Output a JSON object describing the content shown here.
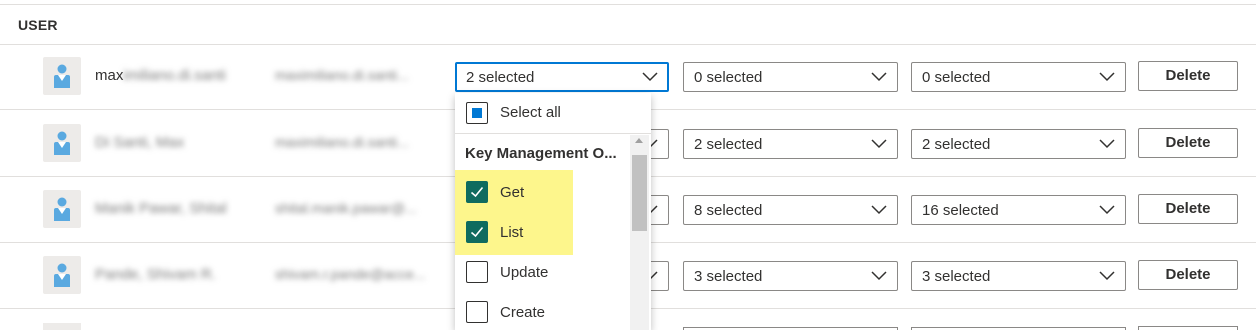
{
  "header": {
    "column_label": "USER"
  },
  "rows": [
    {
      "name_visible": "max",
      "name_obscured": "imiliano.di.santi",
      "email": "maximiliano.di.santi...",
      "dd1": "2 selected",
      "dd2": "0 selected",
      "dd3": "0 selected",
      "delete": "Delete"
    },
    {
      "name_obscured": "Di Santi, Max",
      "email": "maximiliano.di.santi...",
      "dd1": "",
      "dd2": "2 selected",
      "dd3": "2 selected",
      "delete": "Delete"
    },
    {
      "name_obscured": "Manik Pawar, Shital",
      "email": "shital.manik.pawar@...",
      "dd1": "",
      "dd2": "8 selected",
      "dd3": "16 selected",
      "delete": "Delete"
    },
    {
      "name_obscured": "Pande, Shivam R.",
      "email": "shivam.r.pande@acce...",
      "dd1": "",
      "dd2": "3 selected",
      "dd3": "3 selected",
      "delete": "Delete"
    }
  ],
  "dropdown": {
    "select_all": "Select all",
    "group_label": "Key Management O...",
    "options": [
      {
        "label": "Get",
        "checked": true
      },
      {
        "label": "List",
        "checked": true
      },
      {
        "label": "Update",
        "checked": false
      },
      {
        "label": "Create",
        "checked": false
      }
    ]
  },
  "colors": {
    "accent": "#0078d4",
    "checkbox_checked": "#0f6b5f",
    "highlight": "#fdf68c",
    "border": "#8a8886"
  },
  "icons": {
    "avatar": "user-avatar-icon",
    "chevron": "chevron-down-icon",
    "check": "checkmark-icon"
  }
}
